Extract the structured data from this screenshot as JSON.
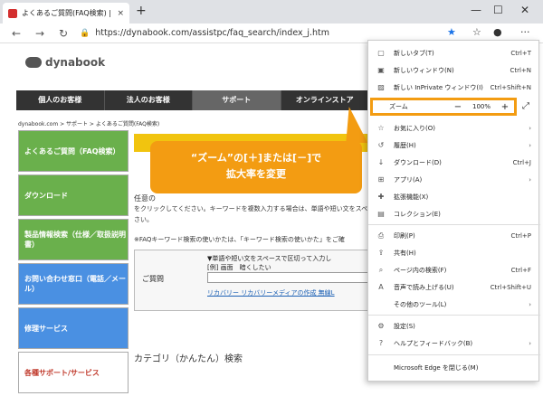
{
  "tab": {
    "title": "よくあるご質問(FAQ検索) | サポート",
    "close": "×",
    "new": "+"
  },
  "window": {
    "minimize": "—",
    "maximize": "☐",
    "close": "✕"
  },
  "nav": {
    "back": "←",
    "forward": "→",
    "refresh": "↻"
  },
  "address": {
    "url": "https://dynabook.com/assistpc/faq_search/index_j.htm"
  },
  "toolbar": {
    "favorite": "★",
    "more": "···"
  },
  "site": {
    "logo": "dynabook",
    "gnav": [
      "個人のお客様",
      "法人のお客様",
      "サポート",
      "オンラインストア"
    ],
    "breadcrumb": "dynabook.com > サポート > よくあるご質問(FAQ検索)",
    "left_nav": [
      "よくあるご質問（FAQ検索）",
      "ダウンロード",
      "製品情報検索（仕様／取扱説明書）",
      "お問い合わせ窓口（電話／メール）",
      "修理サービス",
      "各種サポート/サービス"
    ],
    "intro1": "任意の",
    "intro2": "をクリックしてください。キーワードを複数入力する場合は、単語や短い文をスペ",
    "intro3": "さい。",
    "note": "※FAQキーワード検索の使いかたは、「キーワード検索の使いかた」をご確",
    "search_label": "ご質問",
    "search_instr": "▼単語や短い文をスペースで区切って入力し",
    "search_example": "[例] 画面　暗くしたい",
    "search_links": "リカバリー  リカバリーメディアの作成  無線L",
    "category": "カテゴリ（かんたん）検索"
  },
  "callout": {
    "line1": "“ズーム”の[＋]または[－]で",
    "line2": "拡大率を変更"
  },
  "menu": {
    "new_tab": {
      "label": "新しいタブ(T)",
      "shortcut": "Ctrl+T"
    },
    "new_window": {
      "label": "新しいウィンドウ(N)",
      "shortcut": "Ctrl+N"
    },
    "new_private": {
      "label": "新しい InPrivate ウィンドウ(I)",
      "shortcut": "Ctrl+Shift+N"
    },
    "zoom": {
      "label": "ズーム",
      "minus": "−",
      "value": "100%",
      "plus": "+"
    },
    "favorites": {
      "label": "お気に入り(O)"
    },
    "history": {
      "label": "履歴(H)"
    },
    "downloads": {
      "label": "ダウンロード(D)",
      "shortcut": "Ctrl+J"
    },
    "apps": {
      "label": "アプリ(A)"
    },
    "extensions": {
      "label": "拡張機能(X)"
    },
    "collections": {
      "label": "コレクション(E)"
    },
    "print": {
      "label": "印刷(P)",
      "shortcut": "Ctrl+P"
    },
    "share": {
      "label": "共有(H)"
    },
    "find": {
      "label": "ページ内の検索(F)",
      "shortcut": "Ctrl+F"
    },
    "read_aloud": {
      "label": "音声で読み上げる(U)",
      "shortcut": "Ctrl+Shift+U"
    },
    "more_tools": {
      "label": "その他のツール(L)"
    },
    "settings": {
      "label": "設定(S)"
    },
    "help": {
      "label": "ヘルプとフィードバック(B)"
    },
    "close_edge": {
      "label": "Microsoft Edge を閉じる(M)"
    }
  }
}
